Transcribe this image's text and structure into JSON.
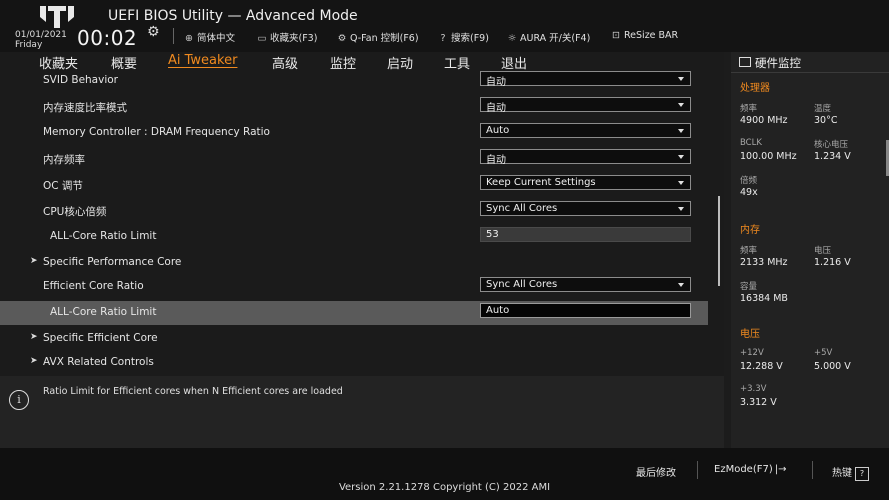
{
  "header": {
    "title": "UEFI BIOS Utility — Advanced Mode",
    "date": "01/01/2021",
    "day": "Friday",
    "time": "00:02",
    "toolbar": [
      {
        "icon": "globe-icon",
        "glyph": "⊕",
        "label": "简体中文"
      },
      {
        "icon": "favorites-icon",
        "glyph": "▭",
        "label": "收藏夹(F3)"
      },
      {
        "icon": "fan-icon",
        "glyph": "⚙",
        "label": "Q-Fan 控制(F6)"
      },
      {
        "icon": "help-search-icon",
        "glyph": "?",
        "label": "搜索(F9)"
      },
      {
        "icon": "aura-icon",
        "glyph": "☼",
        "label": "AURA 开/关(F4)"
      },
      {
        "icon": "resize-bar-icon",
        "glyph": "⊡",
        "label": "ReSize BAR"
      }
    ]
  },
  "nav": {
    "tabs": [
      "收藏夹",
      "概要",
      "Ai Tweaker",
      "高级",
      "监控",
      "启动",
      "工具",
      "退出"
    ],
    "active": 2
  },
  "settings": [
    {
      "label": "SVID Behavior",
      "type": "dropdown",
      "value": "自动"
    },
    {
      "label": "内存速度比率模式",
      "type": "dropdown",
      "value": "自动"
    },
    {
      "label": "Memory Controller : DRAM Frequency Ratio",
      "type": "dropdown",
      "value": "Auto"
    },
    {
      "label": "内存频率",
      "type": "dropdown",
      "value": "自动"
    },
    {
      "label": "OC 调节",
      "type": "dropdown",
      "value": "Keep Current Settings"
    },
    {
      "label": "CPU核心倍频",
      "type": "dropdown",
      "value": "Sync All Cores"
    },
    {
      "label": "ALL-Core Ratio Limit",
      "type": "readonly",
      "value": "53"
    },
    {
      "label": "Specific Performance Core",
      "type": "submenu",
      "value": ""
    },
    {
      "label": "Efficient Core Ratio",
      "type": "dropdown",
      "value": "Sync All Cores"
    },
    {
      "label": "ALL-Core Ratio Limit",
      "type": "editing",
      "value": "Auto"
    },
    {
      "label": "Specific Efficient Core",
      "type": "submenu",
      "value": ""
    },
    {
      "label": "AVX Related Controls",
      "type": "submenu",
      "value": ""
    }
  ],
  "help": {
    "text": "Ratio Limit for Efficient cores when N Efficient cores are loaded"
  },
  "hardware_monitor": {
    "title": "硬件监控",
    "sections": [
      {
        "title": "处理器",
        "items": [
          {
            "label": "频率",
            "value": "4900 MHz"
          },
          {
            "label": "温度",
            "value": "30°C"
          },
          {
            "label": "BCLK",
            "value": "100.00 MHz"
          },
          {
            "label": "核心电压",
            "value": "1.234 V"
          },
          {
            "label": "倍频",
            "value": "49x"
          }
        ]
      },
      {
        "title": "内存",
        "items": [
          {
            "label": "频率",
            "value": "2133 MHz"
          },
          {
            "label": "电压",
            "value": "1.216 V"
          },
          {
            "label": "容量",
            "value": "16384 MB"
          }
        ]
      },
      {
        "title": "电压",
        "items": [
          {
            "label": "+12V",
            "value": "12.288 V"
          },
          {
            "label": "+5V",
            "value": "5.000 V"
          },
          {
            "label": "+3.3V",
            "value": "3.312 V"
          }
        ]
      }
    ]
  },
  "footer": {
    "last_modified": "最后修改",
    "ezmode": "EzMode(F7)",
    "hotkeys": "热键",
    "hotkeys_badge": "?",
    "version": "Version 2.21.1278 Copyright (C) 2022 AMI"
  },
  "colors": {
    "accent": "#f08a1f",
    "background": "#1b1b1b",
    "selected_row": "#5a5a5a"
  }
}
